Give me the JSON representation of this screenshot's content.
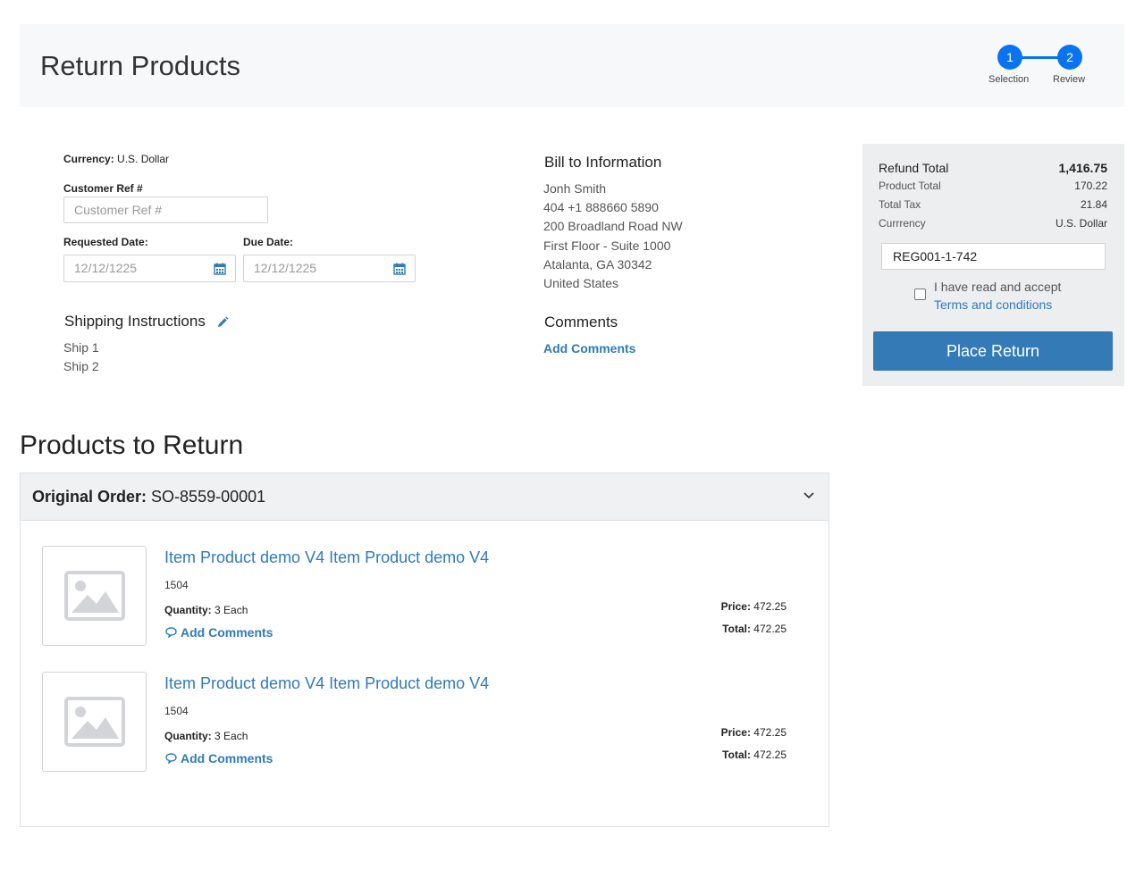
{
  "header": {
    "title": "Return Products",
    "steps": [
      {
        "number": "1",
        "label": "Selection"
      },
      {
        "number": "2",
        "label": "Review"
      }
    ]
  },
  "form": {
    "currency_label": "Currency:",
    "currency_value": "U.S. Dollar",
    "customer_ref_label": "Customer Ref #",
    "customer_ref_placeholder": "Customer Ref #",
    "requested_date_label": "Requested Date:",
    "requested_date_value": "12/12/1225",
    "due_date_label": "Due Date:",
    "due_date_value": "12/12/1225",
    "shipping_heading": "Shipping Instructions",
    "shipping_lines": [
      "Ship 1",
      "Ship 2"
    ]
  },
  "bill_to": {
    "heading": "Bill to Information",
    "lines": [
      "Jonh Smith",
      "404 +1 888660 5890",
      "200 Broadland Road NW",
      "First Floor - Suite 1000",
      "Atalanta, GA 30342",
      "United States"
    ],
    "comments_heading": "Comments",
    "add_comments_label": "Add Comments"
  },
  "summary": {
    "refund_total_label": "Refund Total",
    "refund_total_value": "1,416.75",
    "product_total_label": "Product Total",
    "product_total_value": "170.22",
    "total_tax_label": "Total Tax",
    "total_tax_value": "21.84",
    "currency_label": "Currrency",
    "currency_value": "U.S. Dollar",
    "reg_value": "REG001-1-742",
    "accept_text": "I have read and accept",
    "terms_link": "Terms and conditions",
    "place_button": "Place Return"
  },
  "products": {
    "heading": "Products to Return",
    "order_label": "Original Order:",
    "order_number": "SO-8559-00001",
    "items": [
      {
        "name": "Item Product demo V4 Item Product demo V4",
        "sku": "1504",
        "quantity_label": "Quantity:",
        "quantity_value": "3 Each",
        "comment_label": "Add Comments",
        "price_label": "Price:",
        "price_value": "472.25",
        "total_label": "Total:",
        "total_value": "472.25"
      },
      {
        "name": "Item Product demo V4 Item Product demo V4",
        "sku": "1504",
        "quantity_label": "Quantity:",
        "quantity_value": "3 Each",
        "comment_label": "Add Comments",
        "price_label": "Price:",
        "price_value": "472.25",
        "total_label": "Total:",
        "total_value": "472.25"
      }
    ]
  },
  "colors": {
    "accent": "#0a74f0",
    "link": "#2f7ab9",
    "button": "#337ab7",
    "panel_bg": "#edeeef"
  }
}
